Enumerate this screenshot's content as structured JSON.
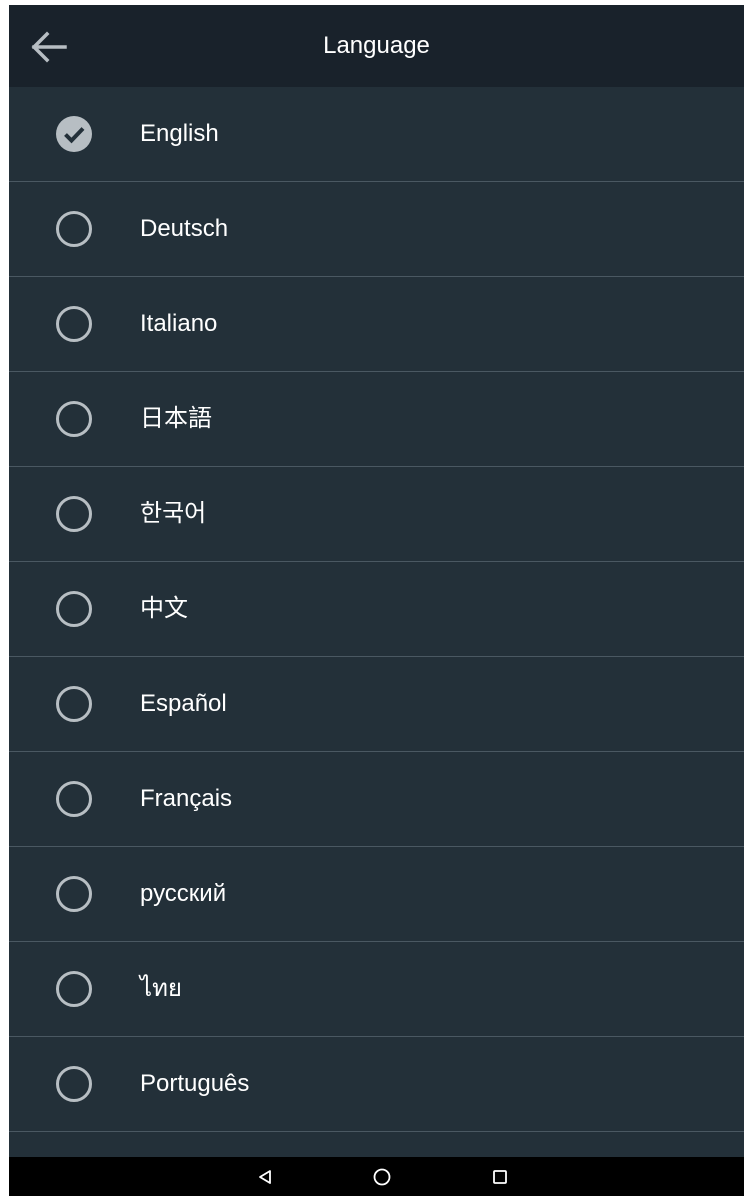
{
  "appbar": {
    "title": "Language",
    "back_icon": "arrow-left-icon"
  },
  "languages": [
    {
      "label": "English",
      "selected": true
    },
    {
      "label": "Deutsch",
      "selected": false
    },
    {
      "label": "Italiano",
      "selected": false
    },
    {
      "label": "日本語",
      "selected": false
    },
    {
      "label": "한국어",
      "selected": false
    },
    {
      "label": "中文",
      "selected": false
    },
    {
      "label": "Español",
      "selected": false
    },
    {
      "label": "Français",
      "selected": false
    },
    {
      "label": "русский",
      "selected": false
    },
    {
      "label": "ไทย",
      "selected": false
    },
    {
      "label": "Português",
      "selected": false
    }
  ],
  "navbar": {
    "back_icon": "triangle-back-icon",
    "home_icon": "circle-home-icon",
    "recents_icon": "square-recents-icon"
  },
  "colors": {
    "background": "#233039",
    "appbar": "#19222b",
    "divider": "#4a5862",
    "radio": "#b7bec3",
    "text": "#ffffff"
  }
}
